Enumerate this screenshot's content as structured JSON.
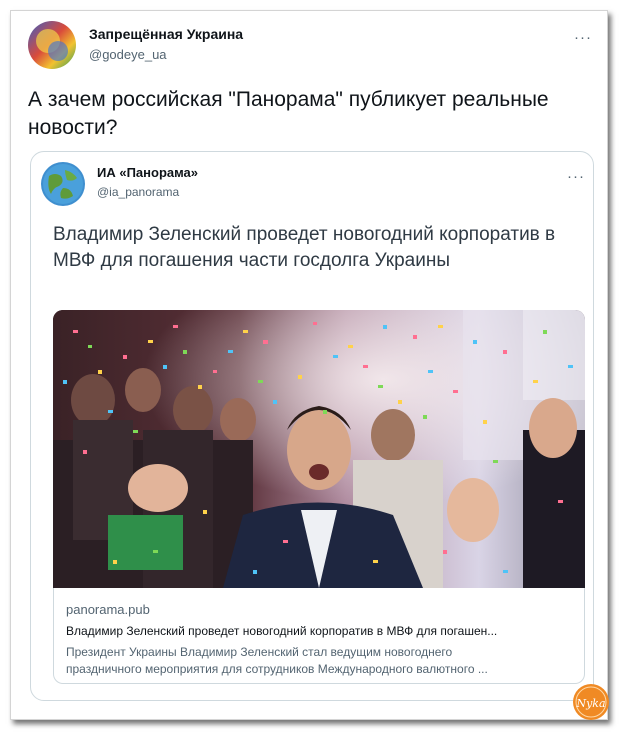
{
  "tweet": {
    "author_name": "Запрещённая Украина",
    "author_handle": "@godeye_ua",
    "text": "А зачем российская \"Панорама\" публикует реальные новости?",
    "more_icon": "ellipsis-icon"
  },
  "quoted_tweet": {
    "author_name": "ИА «Панорама»",
    "author_handle": "@ia_panorama",
    "text": "Владимир Зеленский проведет новогодний корпоратив в МВФ для погашения части госдолга Украины",
    "more_icon": "ellipsis-icon"
  },
  "link_card": {
    "domain": "panorama.pub",
    "headline": "Владимир Зеленский проведет новогодний корпоратив в МВФ для погашен...",
    "description_line1": "Президент Украины Владимир Зеленский стал ведущим новогоднего",
    "description_line2": "праздничного мероприятия для сотрудников Международного валютного ...",
    "image_icon": "celebration-photo"
  },
  "watermark": {
    "text": "Nyka",
    "color": "#f08a24"
  }
}
